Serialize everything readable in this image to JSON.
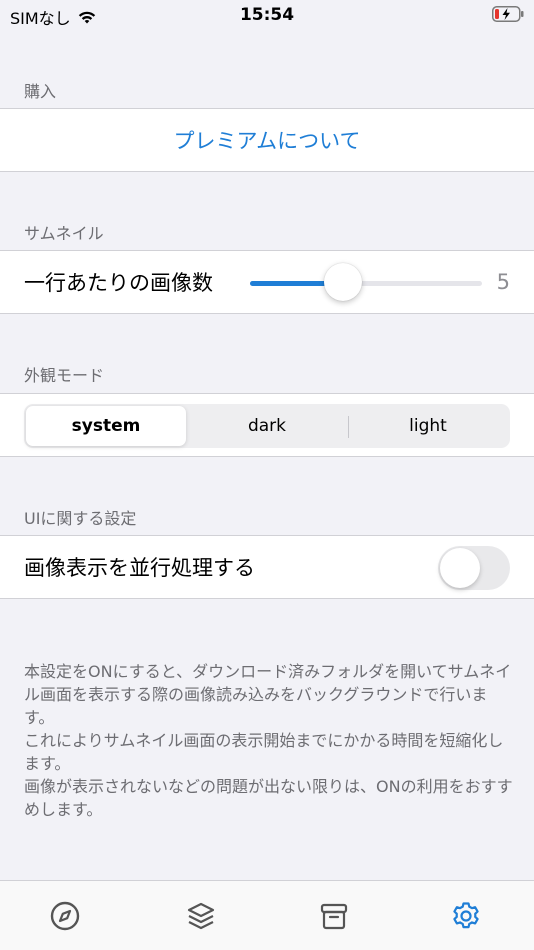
{
  "status_bar": {
    "carrier": "SIMなし",
    "time": "15:54"
  },
  "sections": {
    "purchase": {
      "header": "購入",
      "premium_link": "プレミアムについて"
    },
    "thumbnail": {
      "header": "サムネイル",
      "images_per_row_label": "一行あたりの画像数",
      "images_per_row_value": "5",
      "slider_fraction": 0.4
    },
    "appearance": {
      "header": "外観モード",
      "options": [
        "system",
        "dark",
        "light"
      ],
      "selected": "system"
    },
    "ui_settings": {
      "header": "UIに関する設定",
      "parallel_label": "画像表示を並行処理する",
      "parallel_enabled": false,
      "note": "本設定をONにすると、ダウンロード済みフォルダを開いてサムネイル画面を表示する際の画像読み込みをバックグラウンドで行います。\nこれによりサムネイル画面の表示開始までにかかる時間を短縮化します。\n画像が表示されないなどの問題が出ない限りは、ONの利用をおすすめします。"
    }
  },
  "tab_bar": {
    "items": [
      {
        "icon": "compass-icon",
        "active": false
      },
      {
        "icon": "layers-icon",
        "active": false
      },
      {
        "icon": "archive-box-icon",
        "active": false
      },
      {
        "icon": "gear-icon",
        "active": true
      }
    ]
  },
  "colors": {
    "accent": "#1f7ed6",
    "battery_low": "#e5352d"
  }
}
